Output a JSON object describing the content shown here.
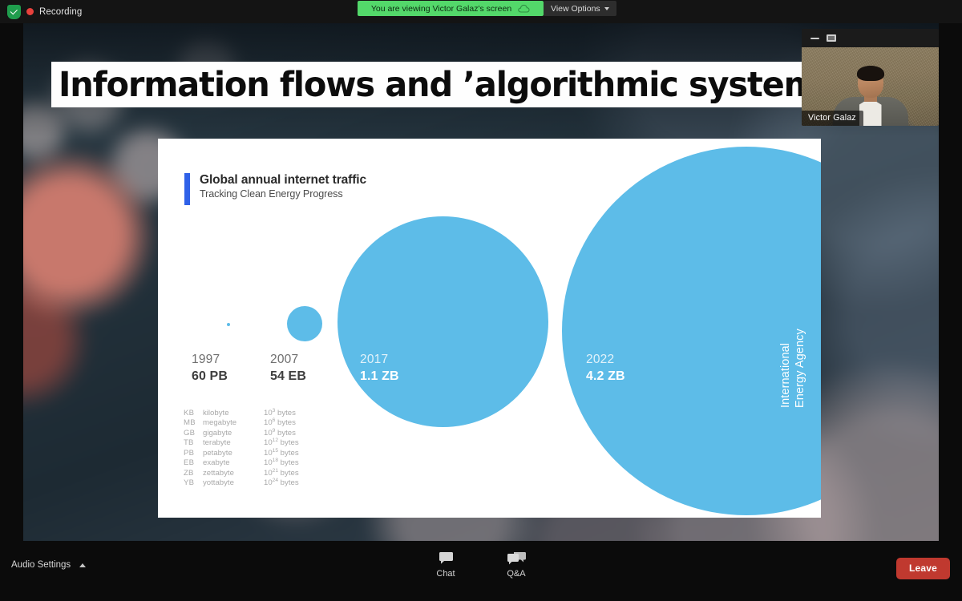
{
  "topbar": {
    "recording_label": "Recording",
    "shield_icon": "shield-check-icon",
    "share_notice": "You are viewing Victor Galaz's screen",
    "cloud_icon": "cloud-icon",
    "view_options_label": "View Options",
    "chevron_icon": "chevron-down-icon"
  },
  "video": {
    "participant_name": "Victor Galaz",
    "minimize_icon": "minimize-icon",
    "maximize_icon": "maximize-icon"
  },
  "slide": {
    "title": "Information flows and ’algorithmic systems’"
  },
  "chart_data": {
    "type": "bubble",
    "title": "Global annual internet traffic",
    "subtitle": "Tracking Clean Energy Progress",
    "source": "International Energy Agency",
    "accent_color": "#2f61e8",
    "bubble_color": "#5dbce8",
    "categories": [
      "1997",
      "2007",
      "2017",
      "2022"
    ],
    "labels": [
      "60 PB",
      "54 EB",
      "1.1 ZB",
      "4.2 ZB"
    ],
    "values_bytes": [
      6e+16,
      5.4e+19,
      1.1e+21,
      4.2e+21
    ],
    "points": [
      {
        "year": "1997",
        "value": "60 PB",
        "label_style": "dark"
      },
      {
        "year": "2007",
        "value": "54 EB",
        "label_style": "dark"
      },
      {
        "year": "2017",
        "value": "1.1 ZB",
        "label_style": "light"
      },
      {
        "year": "2022",
        "value": "4.2 ZB",
        "label_style": "light"
      }
    ],
    "unit_legend": [
      {
        "abbr": "KB",
        "name": "kilobyte",
        "mantissa": "10",
        "exponent": "3",
        "suffix": " bytes"
      },
      {
        "abbr": "MB",
        "name": "megabyte",
        "mantissa": "10",
        "exponent": "6",
        "suffix": " bytes"
      },
      {
        "abbr": "GB",
        "name": "gigabyte",
        "mantissa": "10",
        "exponent": "9",
        "suffix": " bytes"
      },
      {
        "abbr": "TB",
        "name": "terabyte",
        "mantissa": "10",
        "exponent": "12",
        "suffix": " bytes"
      },
      {
        "abbr": "PB",
        "name": "petabyte",
        "mantissa": "10",
        "exponent": "15",
        "suffix": " bytes"
      },
      {
        "abbr": "EB",
        "name": "exabyte",
        "mantissa": "10",
        "exponent": "18",
        "suffix": " bytes"
      },
      {
        "abbr": "ZB",
        "name": "zettabyte",
        "mantissa": "10",
        "exponent": "21",
        "suffix": " bytes"
      },
      {
        "abbr": "YB",
        "name": "yottabyte",
        "mantissa": "10",
        "exponent": "24",
        "suffix": " bytes"
      }
    ],
    "source_line_1": "International",
    "source_line_2": "Energy Agency"
  },
  "bottombar": {
    "audio_settings_label": "Audio Settings",
    "caret_icon": "chevron-up-icon",
    "tools": [
      {
        "label": "Chat",
        "icon": "chat-bubble-icon"
      },
      {
        "label": "Q&A",
        "icon": "qa-bubbles-icon"
      }
    ],
    "leave_label": "Leave",
    "leave_color": "#c0392f"
  }
}
